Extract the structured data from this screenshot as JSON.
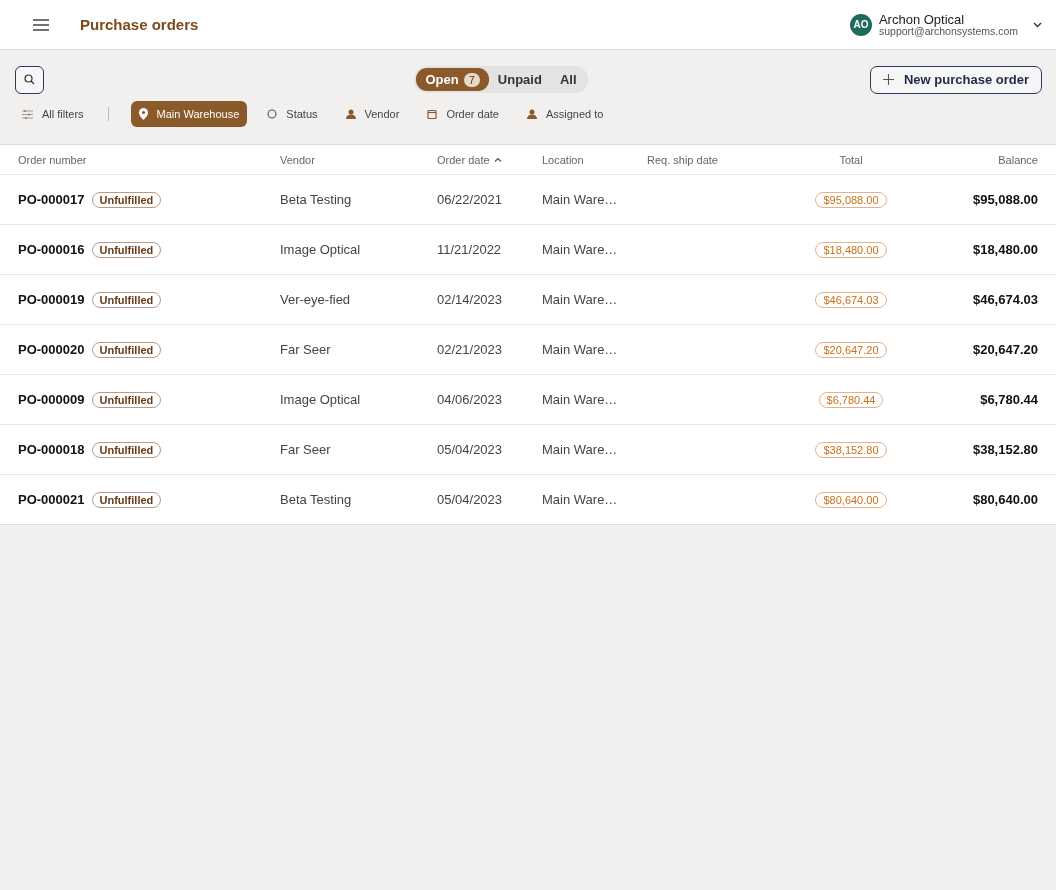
{
  "header": {
    "title": "Purchase orders",
    "account": {
      "initials": "AO",
      "name": "Archon Optical",
      "email": "support@archonsystems.com"
    }
  },
  "tabs": [
    {
      "label": "Open",
      "count": "7",
      "selected": true
    },
    {
      "label": "Unpaid",
      "selected": false
    },
    {
      "label": "All",
      "selected": false
    }
  ],
  "new_button": {
    "label": "New purchase order"
  },
  "filters": [
    {
      "kind": "all",
      "label": "All filters",
      "selected": false
    },
    {
      "kind": "location",
      "label": "Main Warehouse",
      "selected": true
    },
    {
      "kind": "status",
      "label": "Status",
      "selected": false
    },
    {
      "kind": "vendor",
      "label": "Vendor",
      "selected": false
    },
    {
      "kind": "date",
      "label": "Order date",
      "selected": false
    },
    {
      "kind": "assignee",
      "label": "Assigned to",
      "selected": false
    }
  ],
  "table": {
    "columns": [
      {
        "label": "Order number",
        "sorted": false
      },
      {
        "label": "Vendor",
        "sorted": false
      },
      {
        "label": "Order date",
        "sorted": true
      },
      {
        "label": "Location",
        "sorted": false
      },
      {
        "label": "Req. ship date",
        "sorted": false
      },
      {
        "label": "Total",
        "sorted": false
      },
      {
        "label": "Balance",
        "sorted": false
      }
    ],
    "rows": [
      {
        "order": "PO-000017",
        "status": "Unfulfilled",
        "vendor": "Beta Testing",
        "date": "06/22/2021",
        "location": "Main Ware…",
        "total": "$95,088.00",
        "balance": "$95,088.00"
      },
      {
        "order": "PO-000016",
        "status": "Unfulfilled",
        "vendor": "Image Optical",
        "date": "11/21/2022",
        "location": "Main Ware…",
        "total": "$18,480.00",
        "balance": "$18,480.00"
      },
      {
        "order": "PO-000019",
        "status": "Unfulfilled",
        "vendor": "Ver-eye-fied",
        "date": "02/14/2023",
        "location": "Main Ware…",
        "total": "$46,674.03",
        "balance": "$46,674.03"
      },
      {
        "order": "PO-000020",
        "status": "Unfulfilled",
        "vendor": "Far Seer",
        "date": "02/21/2023",
        "location": "Main Ware…",
        "total": "$20,647.20",
        "balance": "$20,647.20"
      },
      {
        "order": "PO-000009",
        "status": "Unfulfilled",
        "vendor": "Image Optical",
        "date": "04/06/2023",
        "location": "Main Ware…",
        "total": "$6,780.44",
        "balance": "$6,780.44"
      },
      {
        "order": "PO-000018",
        "status": "Unfulfilled",
        "vendor": "Far Seer",
        "date": "05/04/2023",
        "location": "Main Ware…",
        "total": "$38,152.80",
        "balance": "$38,152.80"
      },
      {
        "order": "PO-000021",
        "status": "Unfulfilled",
        "vendor": "Beta Testing",
        "date": "05/04/2023",
        "location": "Main Ware…",
        "total": "$80,640.00",
        "balance": "$80,640.00"
      }
    ]
  }
}
